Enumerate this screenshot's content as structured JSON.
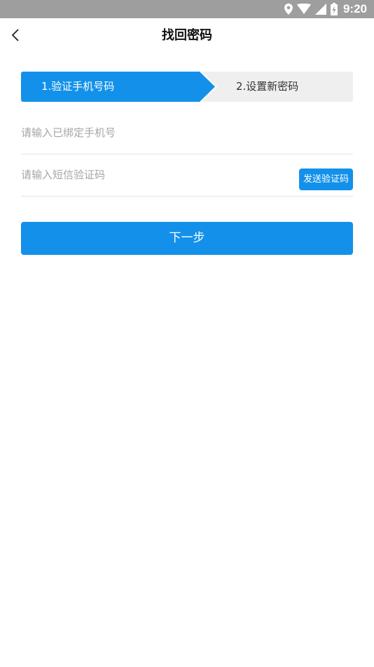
{
  "status_bar": {
    "time": "9:20",
    "icons": [
      "location-icon",
      "wifi-icon",
      "signal-icon",
      "battery-charging-icon"
    ]
  },
  "header": {
    "title": "找回密码",
    "back_icon": "chevron-left-icon"
  },
  "steps": {
    "step1_label": "1.验证手机号码",
    "step2_label": "2.设置新密码",
    "active_color": "#1391ea",
    "inactive_color": "#efefef"
  },
  "form": {
    "phone_placeholder": "请输入已绑定手机号",
    "phone_value": "",
    "code_placeholder": "请输入短信验证码",
    "code_value": "",
    "send_code_label": "发送验证码"
  },
  "actions": {
    "next_label": "下一步"
  },
  "colors": {
    "accent": "#1391ea",
    "status_bar": "#9e9e9e"
  }
}
